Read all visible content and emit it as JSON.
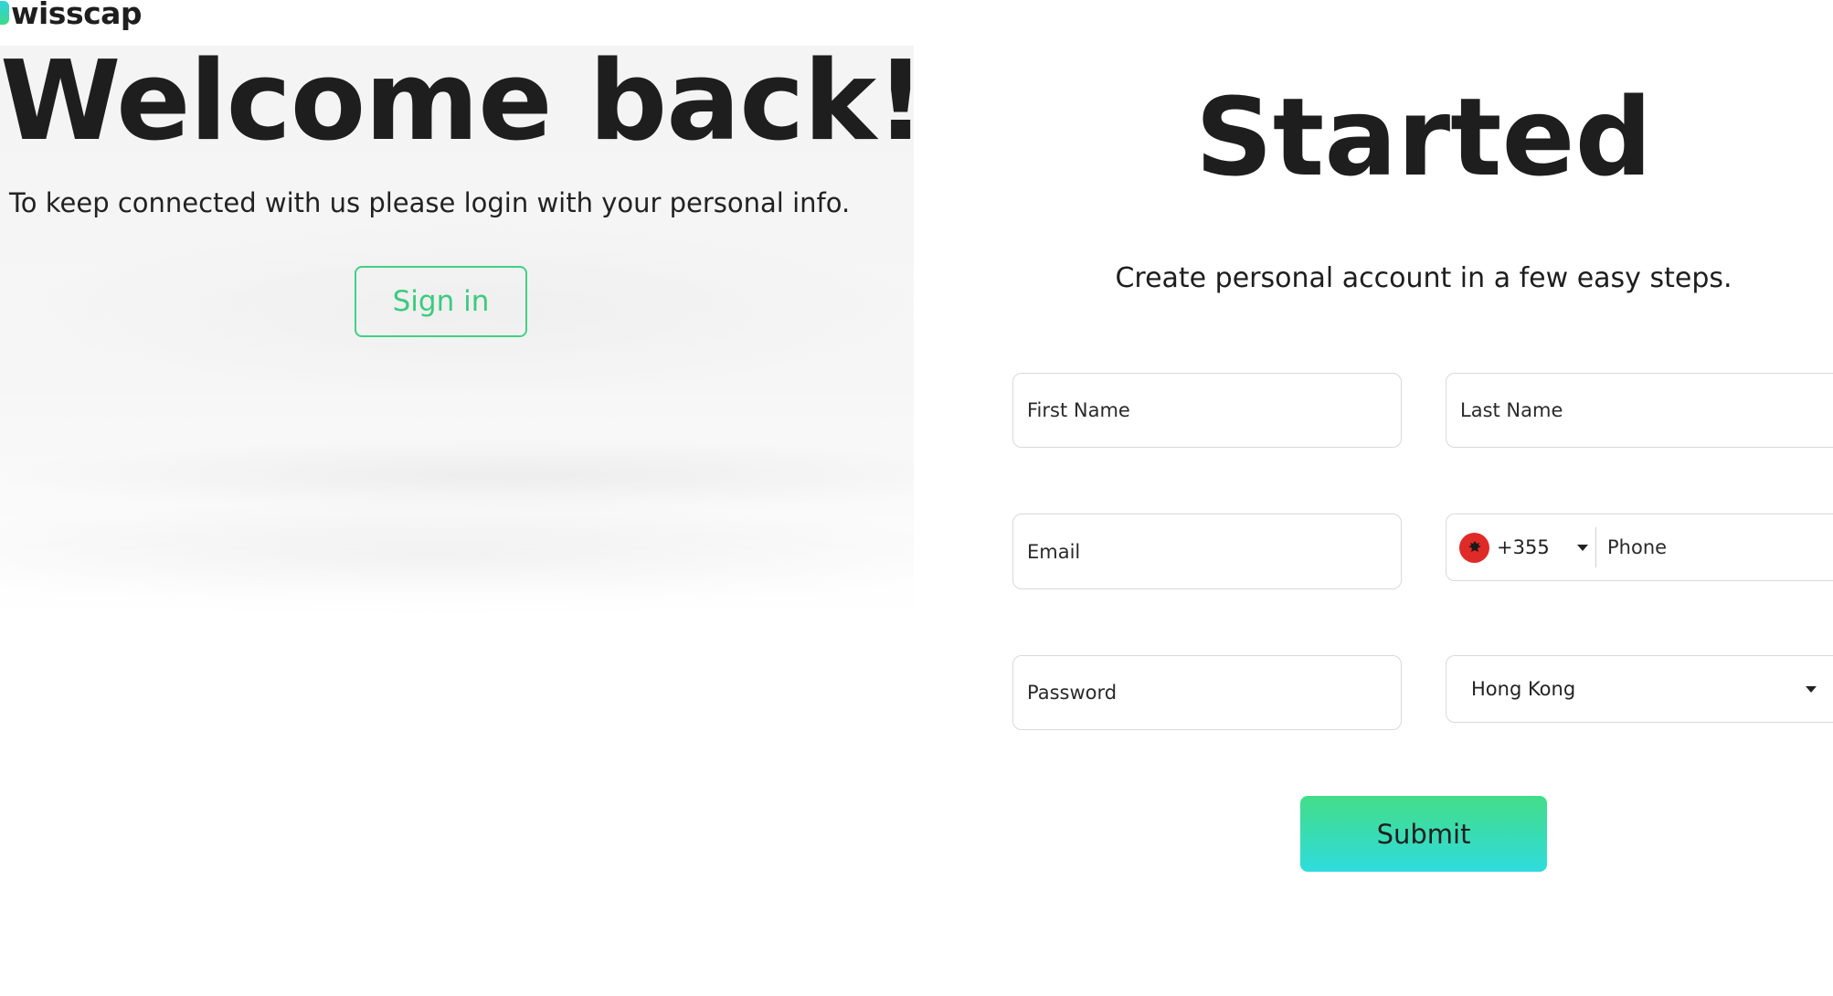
{
  "brand": {
    "logo_text": "wisscap"
  },
  "left": {
    "title": "Welcome back!",
    "subtitle": "To keep connected with us please login with your personal info.",
    "signin_label": "Sign in"
  },
  "right": {
    "title": "Started",
    "subtitle": "Create personal account in a few easy steps.",
    "form": {
      "first_name_placeholder": "First Name",
      "last_name_placeholder": "Last Name",
      "email_placeholder": "Email",
      "phone_code": "+355",
      "phone_flag_icon": "albania-flag-icon",
      "phone_placeholder": "Phone",
      "password_placeholder": "Password",
      "country_value": "Hong Kong",
      "submit_label": "Submit"
    }
  },
  "colors": {
    "accent_green": "#42d185",
    "accent_cyan": "#2fdcdc",
    "text_dark": "#1e1e1e"
  }
}
